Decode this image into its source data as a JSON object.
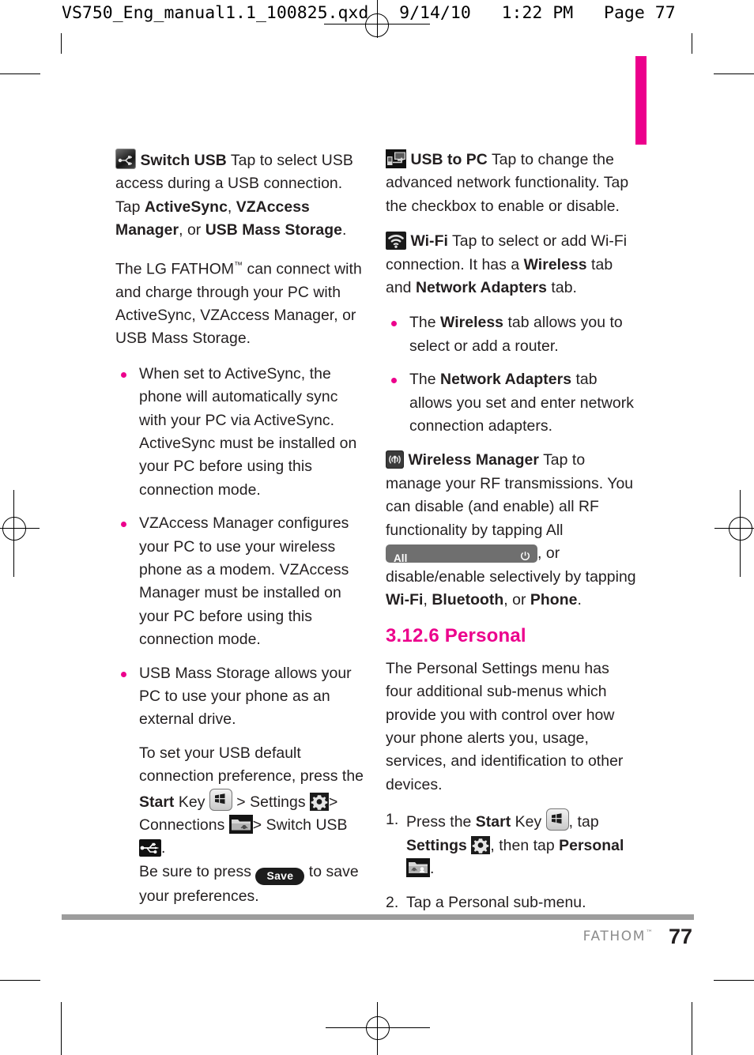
{
  "slug": {
    "text": "VS750_Eng_manual1.1_100825.qxd   9/14/10   1:22 PM   Page 77"
  },
  "colors": {
    "accent_magenta": "#ec008c",
    "body_text": "#231f20",
    "footer_rule": "#9d9d9d",
    "footer_brand": "#8c8c8c",
    "all_bar": "#6f6f6f",
    "save_button": "#1c1c1c"
  },
  "left_column": {
    "switch_usb": {
      "icon": "switch-usb-icon",
      "title": "Switch USB",
      "body_1": "Tap to select USB access during a USB connection. Tap ",
      "bold_1": "ActiveSync",
      "sep_1": ", ",
      "bold_2": "VZAccess Manager",
      "sep_2": ", or ",
      "bold_3": "USB Mass Storage",
      "sep_3": "."
    },
    "paragraph_fathom": {
      "part_1": "The LG FATHOM",
      "tm": "™",
      "part_2": " can connect with and charge through your PC with ActiveSync, VZAccess Manager, or USB Mass Storage."
    },
    "bullets": [
      {
        "text": "When set to ActiveSync, the phone will automatically sync with your PC via ActiveSync. ActiveSync must be installed on your PC before using this connection mode."
      },
      {
        "text": "VZAccess Manager configures your PC to use your wireless phone as a modem. VZAccess Manager must be installed on your PC before using this connection mode."
      },
      {
        "text": "USB Mass Storage allows your PC to use your phone as an external drive."
      }
    ],
    "usb_default": {
      "line_1": "To set your USB default connection preference, press the ",
      "bold_start": "Start",
      "line_2": " Key ",
      "icon_start": "start-key-icon",
      "sep_1": " > Settings ",
      "icon_gear": "settings-gear-icon",
      "sep_2": "> Connections ",
      "icon_folder": "connections-folder-icon",
      "sep_3": "> Switch USB ",
      "icon_usb": "usb-plug-icon",
      "sep_4": ".",
      "line_3": "Be sure to press ",
      "save_label": "Save",
      "line_4": " to save your preferences."
    }
  },
  "right_column": {
    "usb_to_pc": {
      "icon": "usb-to-pc-icon",
      "title": "USB to PC",
      "body": "Tap to change the advanced network functionality. Tap the checkbox to enable or disable."
    },
    "wifi": {
      "icon": "wifi-icon",
      "title": "Wi-Fi",
      "body_1": "Tap to select or add Wi-Fi connection. It has a ",
      "bold_1": "Wireless",
      "body_2": " tab and ",
      "bold_2": "Network Adapters",
      "body_3": " tab."
    },
    "wifi_bullets": [
      {
        "pre": "The ",
        "bold": "Wireless",
        "post": " tab allows you to select or add a router."
      },
      {
        "pre": "The ",
        "bold": "Network Adapters",
        "post": " tab allows you set and enter network connection adapters."
      }
    ],
    "wireless_manager": {
      "icon": "wireless-manager-icon",
      "title": "Wireless Manager",
      "body_1": "Tap to manage your RF transmissions. You can disable (and enable) all RF functionality by tapping All ",
      "all_bar_label": "All",
      "all_bar_power_icon": "power-icon",
      "body_2": ", or disable/enable selectively by tapping ",
      "bold_1": "Wi-Fi",
      "sep_1": ", ",
      "bold_2": "Bluetooth",
      "sep_2": ", or ",
      "bold_3": "Phone",
      "sep_3": "."
    },
    "section": {
      "heading": "3.12.6 Personal",
      "intro": "The Personal Settings menu has four additional sub-menus which provide you with control over how your phone alerts you, usage, services, and identification to other devices.",
      "steps": [
        {
          "pre": "Press the ",
          "bold_1": "Start",
          "mid_1": " Key ",
          "icon_start": "start-key-icon",
          "mid_2": ", tap ",
          "bold_2": "Settings",
          "icon_gear": "settings-gear-icon",
          "mid_3": ", then tap ",
          "bold_3": "Personal",
          "icon_personal": "personal-folder-icon",
          "post": "."
        },
        {
          "plain": "Tap a Personal sub-menu."
        }
      ]
    }
  },
  "footer": {
    "brand": "FATHOM",
    "brand_tm": "™",
    "page_number": "77"
  }
}
